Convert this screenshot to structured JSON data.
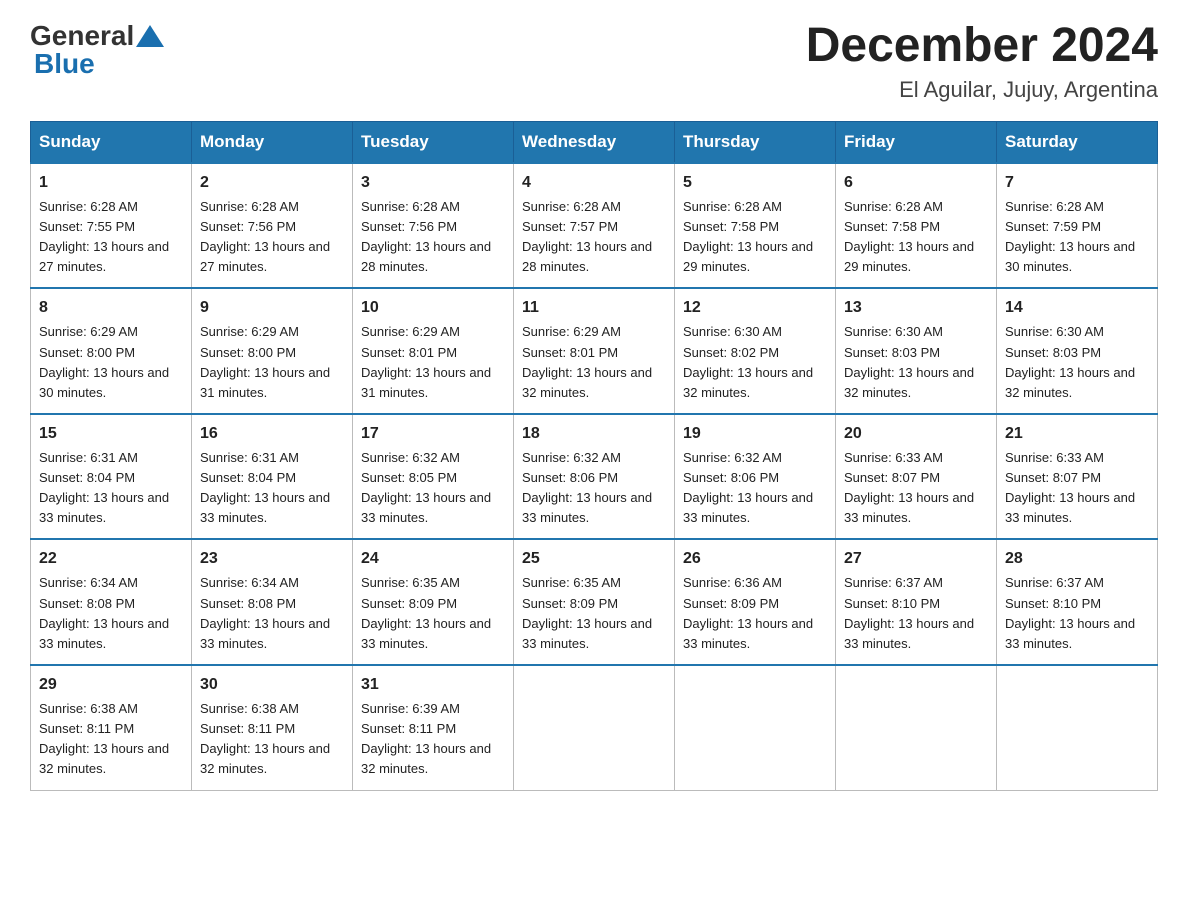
{
  "logo": {
    "general": "General",
    "blue": "Blue"
  },
  "title": {
    "month": "December 2024",
    "location": "El Aguilar, Jujuy, Argentina"
  },
  "days_of_week": [
    "Sunday",
    "Monday",
    "Tuesday",
    "Wednesday",
    "Thursday",
    "Friday",
    "Saturday"
  ],
  "weeks": [
    [
      {
        "day": "1",
        "sunrise": "6:28 AM",
        "sunset": "7:55 PM",
        "daylight": "13 hours and 27 minutes."
      },
      {
        "day": "2",
        "sunrise": "6:28 AM",
        "sunset": "7:56 PM",
        "daylight": "13 hours and 27 minutes."
      },
      {
        "day": "3",
        "sunrise": "6:28 AM",
        "sunset": "7:56 PM",
        "daylight": "13 hours and 28 minutes."
      },
      {
        "day": "4",
        "sunrise": "6:28 AM",
        "sunset": "7:57 PM",
        "daylight": "13 hours and 28 minutes."
      },
      {
        "day": "5",
        "sunrise": "6:28 AM",
        "sunset": "7:58 PM",
        "daylight": "13 hours and 29 minutes."
      },
      {
        "day": "6",
        "sunrise": "6:28 AM",
        "sunset": "7:58 PM",
        "daylight": "13 hours and 29 minutes."
      },
      {
        "day": "7",
        "sunrise": "6:28 AM",
        "sunset": "7:59 PM",
        "daylight": "13 hours and 30 minutes."
      }
    ],
    [
      {
        "day": "8",
        "sunrise": "6:29 AM",
        "sunset": "8:00 PM",
        "daylight": "13 hours and 30 minutes."
      },
      {
        "day": "9",
        "sunrise": "6:29 AM",
        "sunset": "8:00 PM",
        "daylight": "13 hours and 31 minutes."
      },
      {
        "day": "10",
        "sunrise": "6:29 AM",
        "sunset": "8:01 PM",
        "daylight": "13 hours and 31 minutes."
      },
      {
        "day": "11",
        "sunrise": "6:29 AM",
        "sunset": "8:01 PM",
        "daylight": "13 hours and 32 minutes."
      },
      {
        "day": "12",
        "sunrise": "6:30 AM",
        "sunset": "8:02 PM",
        "daylight": "13 hours and 32 minutes."
      },
      {
        "day": "13",
        "sunrise": "6:30 AM",
        "sunset": "8:03 PM",
        "daylight": "13 hours and 32 minutes."
      },
      {
        "day": "14",
        "sunrise": "6:30 AM",
        "sunset": "8:03 PM",
        "daylight": "13 hours and 32 minutes."
      }
    ],
    [
      {
        "day": "15",
        "sunrise": "6:31 AM",
        "sunset": "8:04 PM",
        "daylight": "13 hours and 33 minutes."
      },
      {
        "day": "16",
        "sunrise": "6:31 AM",
        "sunset": "8:04 PM",
        "daylight": "13 hours and 33 minutes."
      },
      {
        "day": "17",
        "sunrise": "6:32 AM",
        "sunset": "8:05 PM",
        "daylight": "13 hours and 33 minutes."
      },
      {
        "day": "18",
        "sunrise": "6:32 AM",
        "sunset": "8:06 PM",
        "daylight": "13 hours and 33 minutes."
      },
      {
        "day": "19",
        "sunrise": "6:32 AM",
        "sunset": "8:06 PM",
        "daylight": "13 hours and 33 minutes."
      },
      {
        "day": "20",
        "sunrise": "6:33 AM",
        "sunset": "8:07 PM",
        "daylight": "13 hours and 33 minutes."
      },
      {
        "day": "21",
        "sunrise": "6:33 AM",
        "sunset": "8:07 PM",
        "daylight": "13 hours and 33 minutes."
      }
    ],
    [
      {
        "day": "22",
        "sunrise": "6:34 AM",
        "sunset": "8:08 PM",
        "daylight": "13 hours and 33 minutes."
      },
      {
        "day": "23",
        "sunrise": "6:34 AM",
        "sunset": "8:08 PM",
        "daylight": "13 hours and 33 minutes."
      },
      {
        "day": "24",
        "sunrise": "6:35 AM",
        "sunset": "8:09 PM",
        "daylight": "13 hours and 33 minutes."
      },
      {
        "day": "25",
        "sunrise": "6:35 AM",
        "sunset": "8:09 PM",
        "daylight": "13 hours and 33 minutes."
      },
      {
        "day": "26",
        "sunrise": "6:36 AM",
        "sunset": "8:09 PM",
        "daylight": "13 hours and 33 minutes."
      },
      {
        "day": "27",
        "sunrise": "6:37 AM",
        "sunset": "8:10 PM",
        "daylight": "13 hours and 33 minutes."
      },
      {
        "day": "28",
        "sunrise": "6:37 AM",
        "sunset": "8:10 PM",
        "daylight": "13 hours and 33 minutes."
      }
    ],
    [
      {
        "day": "29",
        "sunrise": "6:38 AM",
        "sunset": "8:11 PM",
        "daylight": "13 hours and 32 minutes."
      },
      {
        "day": "30",
        "sunrise": "6:38 AM",
        "sunset": "8:11 PM",
        "daylight": "13 hours and 32 minutes."
      },
      {
        "day": "31",
        "sunrise": "6:39 AM",
        "sunset": "8:11 PM",
        "daylight": "13 hours and 32 minutes."
      },
      null,
      null,
      null,
      null
    ]
  ]
}
